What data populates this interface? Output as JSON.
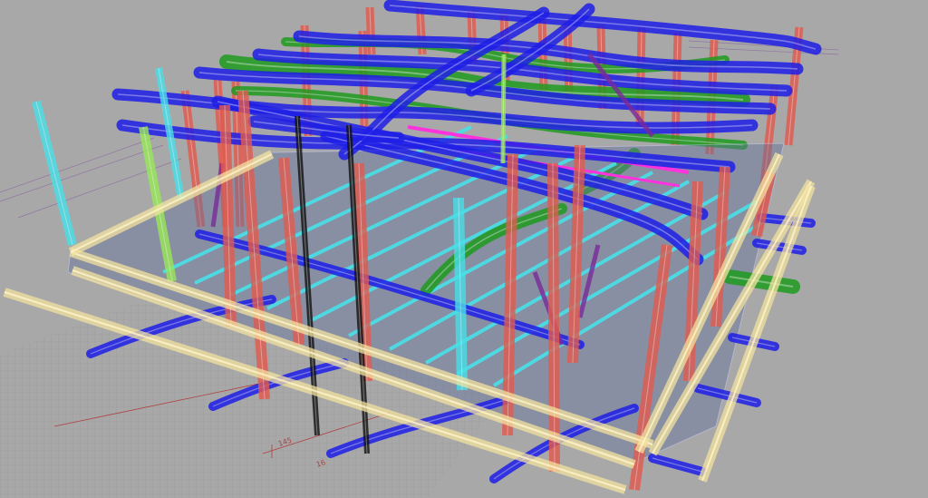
{
  "app": {
    "view": "3d-perspective-viewport",
    "display_mode": "ghosted"
  },
  "legend": {
    "colors": {
      "background": "#a8a8a8",
      "ground_grid": "#9a9a9a",
      "grid_line": "#8f8f8f",
      "columns": "#e25a4e",
      "blue_pipes": "#1e1ee6",
      "green_pipes": "#1f9a1f",
      "cyan_joists": "#48e0e8",
      "yellow_beams": "#f3e2a0",
      "magenta_rails": "#ff33dd",
      "purple_braces": "#7a2a9a",
      "black_posts": "#111111",
      "lime_posts": "#98e858",
      "slab": "#5f6f9a",
      "annotation": "#b04040"
    }
  },
  "dimension_tags": [
    "145",
    "16"
  ]
}
